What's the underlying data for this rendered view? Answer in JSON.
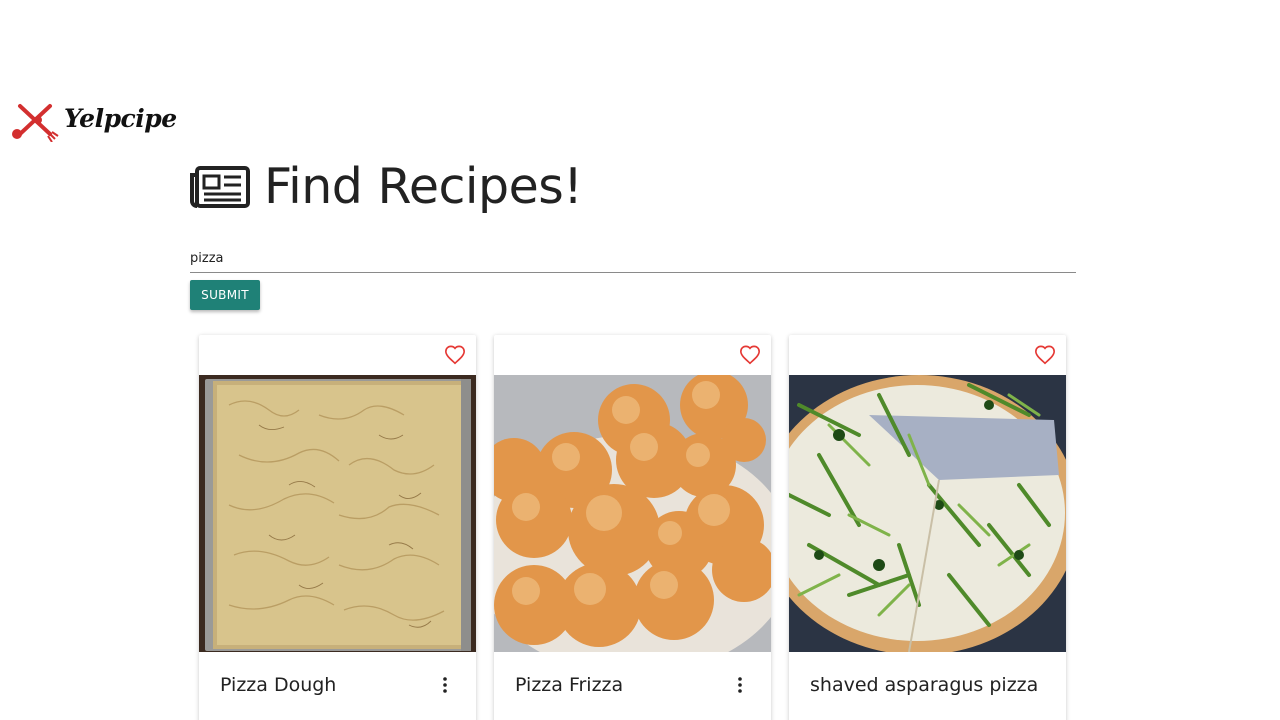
{
  "brand": {
    "name": "Yelpcipe",
    "icon": "crossed-fork-spoon-logo-icon"
  },
  "page": {
    "title": "Find Recipes!",
    "title_icon": "newspaper-icon"
  },
  "search": {
    "value": "pizza",
    "placeholder": ""
  },
  "submit": {
    "label": "SUBMIT"
  },
  "colors": {
    "accent": "#1f8177",
    "heart": "#e53935",
    "logo_red": "#d32f2f"
  },
  "recipes": [
    {
      "title": "Pizza Dough",
      "favorite": false,
      "favorite_icon": "heart-outline-icon",
      "menu_icon": "more-vert-icon",
      "image": "flatbread-with-onions"
    },
    {
      "title": "Pizza Frizza",
      "favorite": false,
      "favorite_icon": "heart-outline-icon",
      "menu_icon": "more-vert-icon",
      "image": "sugared-dough-balls"
    },
    {
      "title": "shaved asparagus pizza",
      "favorite": false,
      "favorite_icon": "heart-outline-icon",
      "menu_icon": "",
      "image": "asparagus-pizza"
    }
  ]
}
